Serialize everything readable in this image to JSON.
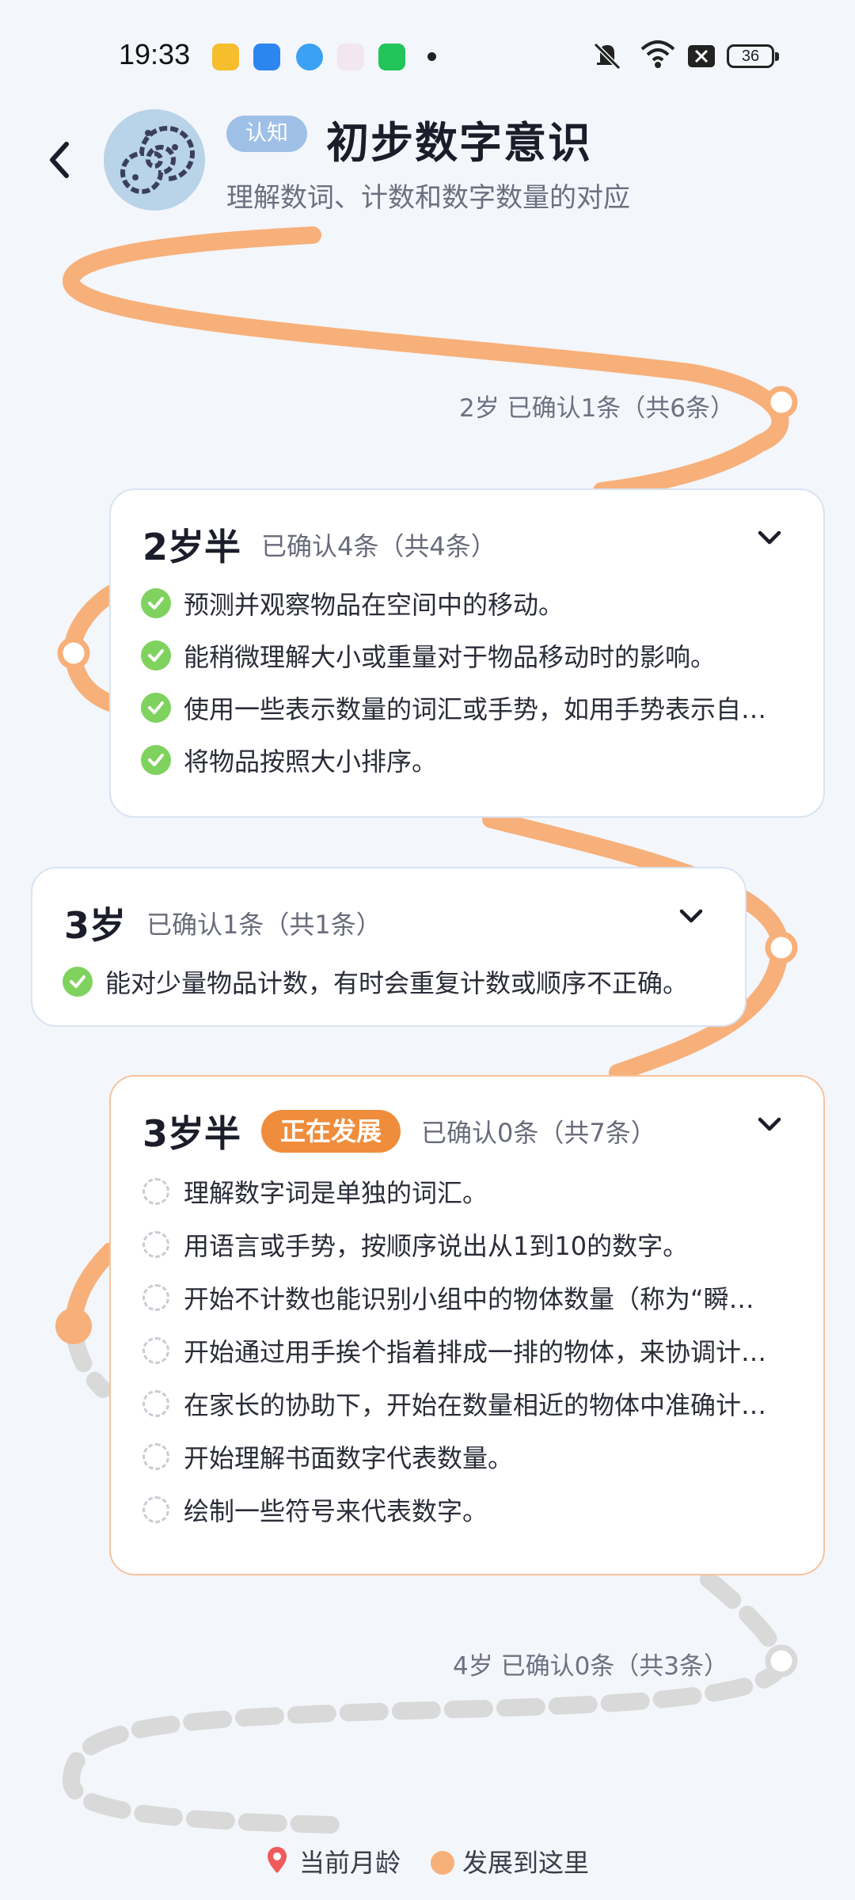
{
  "status_bar": {
    "time": "19:33",
    "battery": "36"
  },
  "header": {
    "tag": "认知",
    "title": "初步数字意识",
    "subtitle": "理解数词、计数和数字数量的对应"
  },
  "milestones": [
    {
      "label": "2岁 已确认1条（共6条）"
    },
    {
      "label": "4岁 已确认0条（共3条）"
    }
  ],
  "cards": [
    {
      "age": "2岁半",
      "count": "已确认4条（共4条）",
      "items": [
        "预测并观察物品在空间中的移动。",
        "能稍微理解大小或重量对于物品移动时的影响。",
        "使用一些表示数量的词汇或手势，如用手势表示自…",
        "将物品按照大小排序。"
      ]
    },
    {
      "age": "3岁",
      "count": "已确认1条（共1条）",
      "items": [
        "能对少量物品计数，有时会重复计数或顺序不正确。"
      ]
    },
    {
      "age": "3岁半",
      "badge": "正在发展",
      "count": "已确认0条（共7条）",
      "items": [
        "理解数字词是单独的词汇。",
        "用语言或手势，按顺序说出从1到10的数字。",
        "开始不计数也能识别小组中的物体数量（称为“瞬…",
        "开始通过用手挨个指着排成一排的物体，来协调计…",
        "在家长的协助下，开始在数量相近的物体中准确计…",
        "开始理解书面数字代表数量。",
        "绘制一些符号来代表数字。"
      ]
    }
  ],
  "legend": {
    "current_age": "当前月龄",
    "developed": "发展到这里"
  },
  "colors": {
    "accent": "#ef8d3c",
    "path": "#f7b07a",
    "check": "#7fd25e",
    "path_future": "#d9d9d9"
  }
}
